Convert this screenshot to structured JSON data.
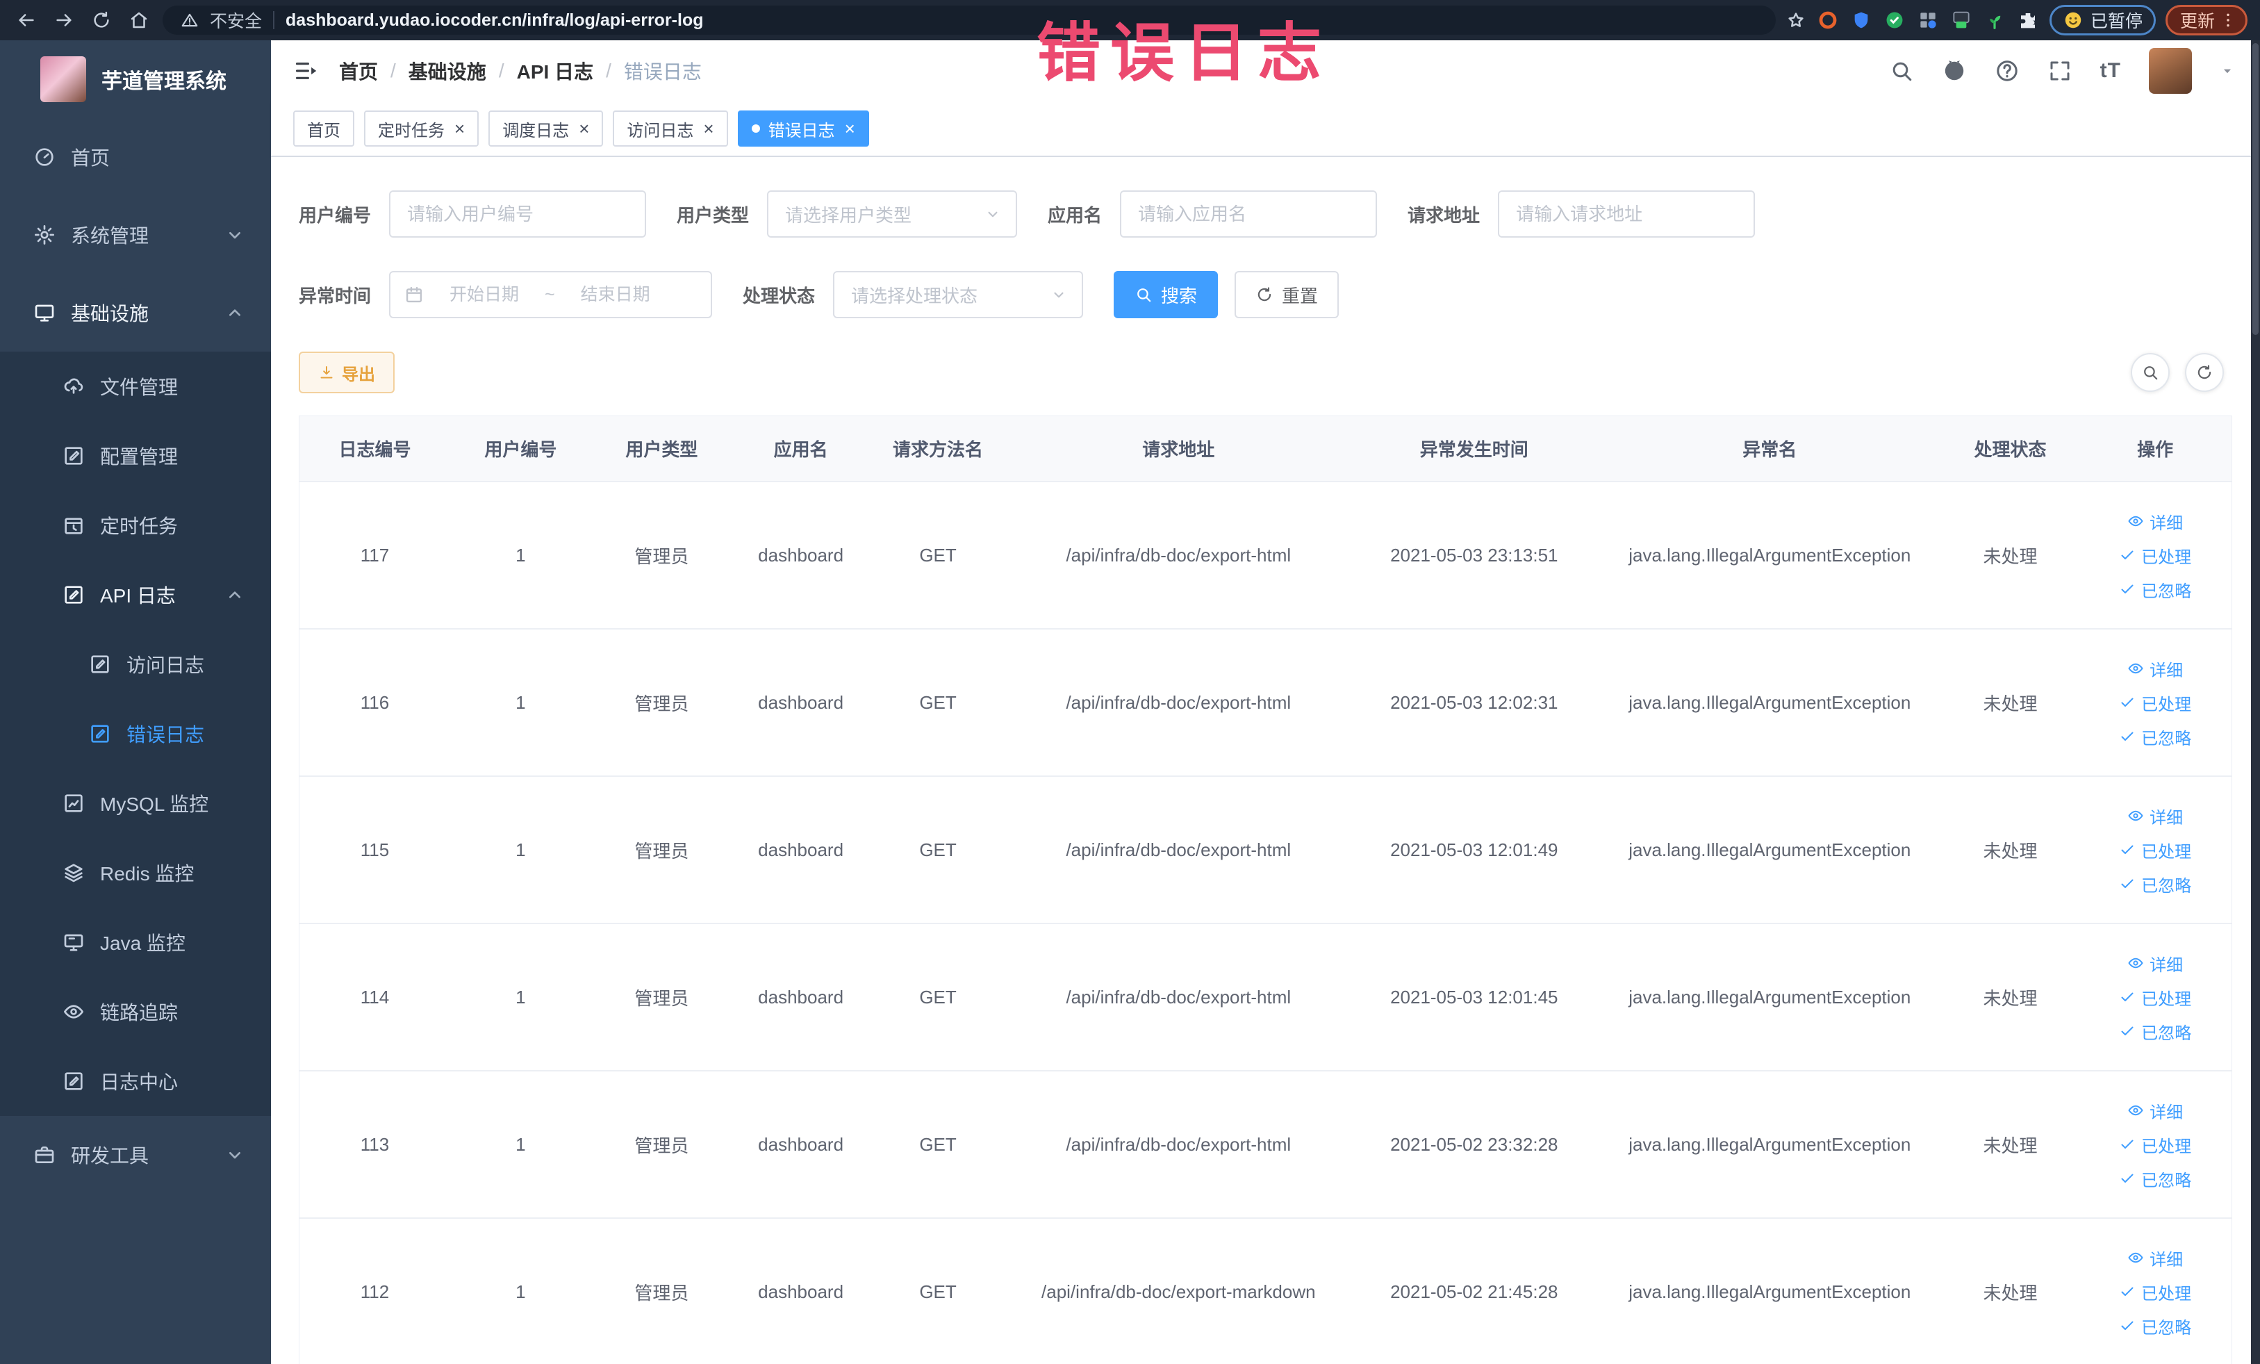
{
  "annotation": "错误日志",
  "browser": {
    "security_label": "不安全",
    "url": "dashboard.yudao.iocoder.cn/infra/log/api-error-log",
    "paused_badge": "已暂停",
    "update_button": "更新"
  },
  "sidebar": {
    "title": "芋道管理系统",
    "menu": [
      {
        "key": "home",
        "label": "首页",
        "icon": "gauge-icon",
        "level": 1
      },
      {
        "key": "system-admin",
        "label": "系统管理",
        "icon": "gear-icon",
        "level": 1,
        "chevron": "down"
      },
      {
        "key": "infrastructure",
        "label": "基础设施",
        "icon": "monitor-icon",
        "level": 1,
        "chevron": "up",
        "open": true
      },
      {
        "key": "file-admin",
        "label": "文件管理",
        "icon": "upload-cloud-icon",
        "level": 2
      },
      {
        "key": "config-admin",
        "label": "配置管理",
        "icon": "edit-square-icon",
        "level": 2
      },
      {
        "key": "scheduled-jobs",
        "label": "定时任务",
        "icon": "timer-icon",
        "level": 2
      },
      {
        "key": "api-log",
        "label": "API 日志",
        "icon": "doc-edit-icon",
        "level": 2,
        "chevron": "up",
        "open": true
      },
      {
        "key": "access-log",
        "label": "访问日志",
        "icon": "doc-edit-icon",
        "level": 3
      },
      {
        "key": "error-log",
        "label": "错误日志",
        "icon": "doc-edit-icon",
        "level": 3,
        "active": true
      },
      {
        "key": "mysql-monitor",
        "label": "MySQL 监控",
        "icon": "chart-icon",
        "level": 2
      },
      {
        "key": "redis-monitor",
        "label": "Redis 监控",
        "icon": "layers-icon",
        "level": 2
      },
      {
        "key": "java-monitor",
        "label": "Java 监控",
        "icon": "desktop-icon",
        "level": 2
      },
      {
        "key": "trace",
        "label": "链路追踪",
        "icon": "eye-icon",
        "level": 2
      },
      {
        "key": "log-center",
        "label": "日志中心",
        "icon": "doc-edit-icon",
        "level": 2
      },
      {
        "key": "dev-tools",
        "label": "研发工具",
        "icon": "briefcase-icon",
        "level": 1,
        "chevron": "down"
      }
    ]
  },
  "header": {
    "breadcrumb": [
      "首页",
      "基础设施",
      "API 日志",
      "错误日志"
    ],
    "font_size_icon_text": "tT"
  },
  "tabs": [
    {
      "key": "home",
      "label": "首页",
      "closable": false,
      "active": false
    },
    {
      "key": "scheduled-jobs",
      "label": "定时任务",
      "closable": true,
      "active": false
    },
    {
      "key": "schedule-log",
      "label": "调度日志",
      "closable": true,
      "active": false
    },
    {
      "key": "access-log",
      "label": "访问日志",
      "closable": true,
      "active": false
    },
    {
      "key": "error-log",
      "label": "错误日志",
      "closable": true,
      "active": true
    }
  ],
  "filters": {
    "user_id": {
      "label": "用户编号",
      "placeholder": "请输入用户编号"
    },
    "user_type": {
      "label": "用户类型",
      "placeholder": "请选择用户类型"
    },
    "app_name": {
      "label": "应用名",
      "placeholder": "请输入应用名"
    },
    "request_url": {
      "label": "请求地址",
      "placeholder": "请输入请求地址"
    },
    "exception_time": {
      "label": "异常时间",
      "start_placeholder": "开始日期",
      "separator": "~",
      "end_placeholder": "结束日期"
    },
    "process_status": {
      "label": "处理状态",
      "placeholder": "请选择处理状态"
    },
    "search_button": "搜索",
    "reset_button": "重置"
  },
  "toolbar": {
    "export_button": "导出"
  },
  "table": {
    "columns": [
      {
        "key": "log_id",
        "label": "日志编号"
      },
      {
        "key": "user_id",
        "label": "用户编号"
      },
      {
        "key": "user_type",
        "label": "用户类型"
      },
      {
        "key": "app_name",
        "label": "应用名"
      },
      {
        "key": "method",
        "label": "请求方法名"
      },
      {
        "key": "url",
        "label": "请求地址"
      },
      {
        "key": "time",
        "label": "异常发生时间"
      },
      {
        "key": "exception",
        "label": "异常名"
      },
      {
        "key": "status",
        "label": "处理状态"
      },
      {
        "key": "actions",
        "label": "操作"
      }
    ],
    "actions": [
      {
        "key": "detail",
        "label": "详细",
        "icon": "eye-icon"
      },
      {
        "key": "processed",
        "label": "已处理",
        "icon": "check-icon"
      },
      {
        "key": "ignored",
        "label": "已忽略",
        "icon": "check-icon"
      }
    ],
    "rows": [
      {
        "log_id": "117",
        "user_id": "1",
        "user_type": "管理员",
        "app_name": "dashboard",
        "method": "GET",
        "url": "/api/infra/db-doc/export-html",
        "time": "2021-05-03 23:13:51",
        "exception": "java.lang.IllegalArgumentException",
        "status": "未处理"
      },
      {
        "log_id": "116",
        "user_id": "1",
        "user_type": "管理员",
        "app_name": "dashboard",
        "method": "GET",
        "url": "/api/infra/db-doc/export-html",
        "time": "2021-05-03 12:02:31",
        "exception": "java.lang.IllegalArgumentException",
        "status": "未处理"
      },
      {
        "log_id": "115",
        "user_id": "1",
        "user_type": "管理员",
        "app_name": "dashboard",
        "method": "GET",
        "url": "/api/infra/db-doc/export-html",
        "time": "2021-05-03 12:01:49",
        "exception": "java.lang.IllegalArgumentException",
        "status": "未处理"
      },
      {
        "log_id": "114",
        "user_id": "1",
        "user_type": "管理员",
        "app_name": "dashboard",
        "method": "GET",
        "url": "/api/infra/db-doc/export-html",
        "time": "2021-05-03 12:01:45",
        "exception": "java.lang.IllegalArgumentException",
        "status": "未处理"
      },
      {
        "log_id": "113",
        "user_id": "1",
        "user_type": "管理员",
        "app_name": "dashboard",
        "method": "GET",
        "url": "/api/infra/db-doc/export-html",
        "time": "2021-05-02 23:32:28",
        "exception": "java.lang.IllegalArgumentException",
        "status": "未处理"
      },
      {
        "log_id": "112",
        "user_id": "1",
        "user_type": "管理员",
        "app_name": "dashboard",
        "method": "GET",
        "url": "/api/infra/db-doc/export-markdown",
        "time": "2021-05-02 21:45:28",
        "exception": "java.lang.IllegalArgumentException",
        "status": "未处理"
      }
    ]
  }
}
